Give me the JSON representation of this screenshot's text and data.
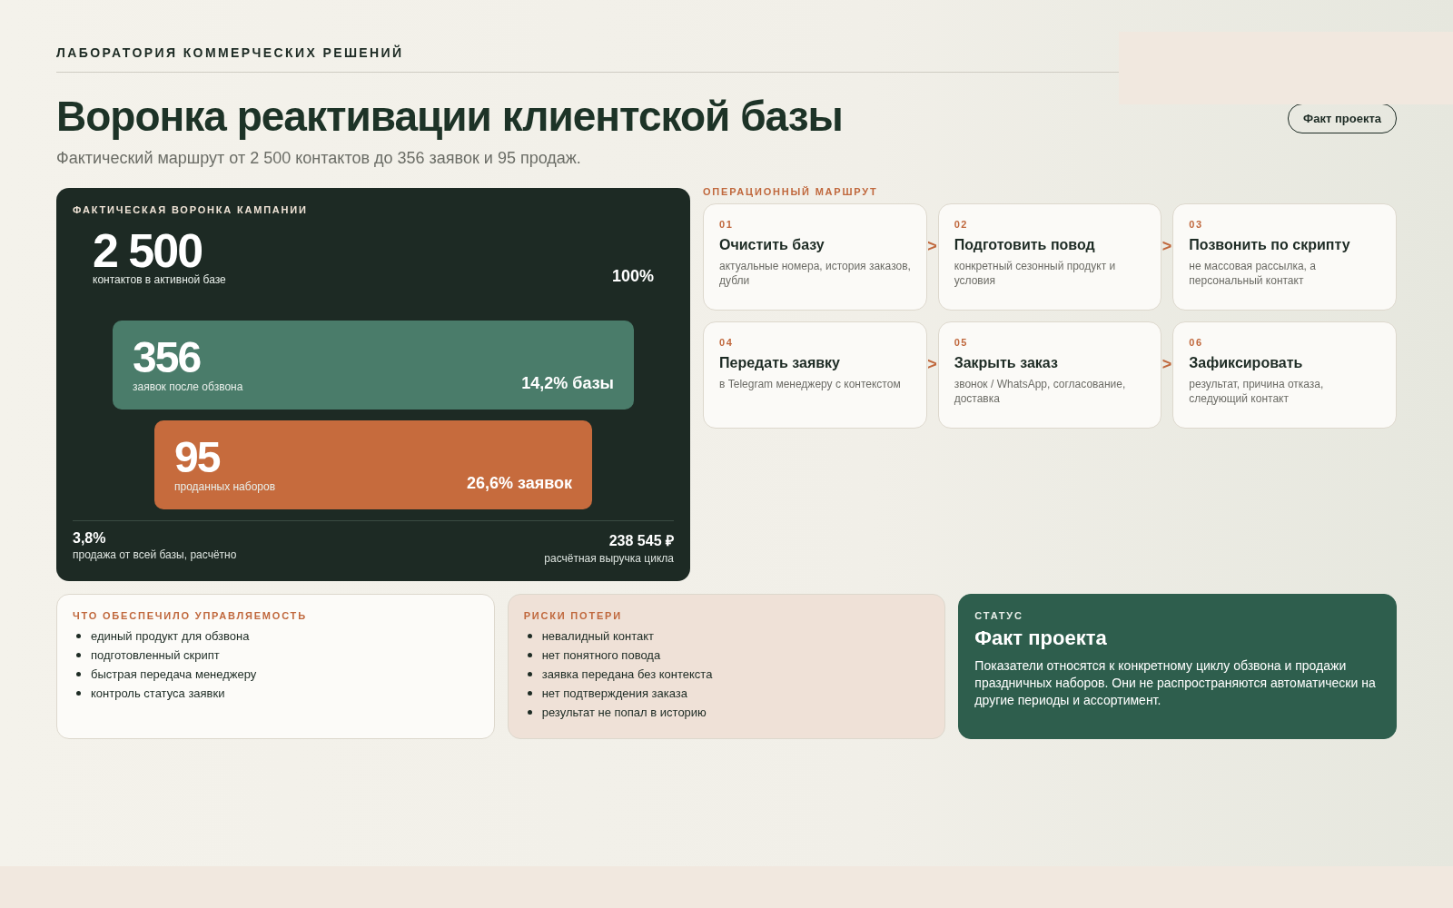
{
  "header": {
    "eyebrow": "ЛАБОРАТОРИЯ КОММЕРЧЕСКИХ РЕШЕНИЙ",
    "title": "Воронка реактивации клиентской базы",
    "subtitle": "Фактический маршрут от 2 500 контактов до 356 заявок и 95 продаж.",
    "badge": "Факт проекта"
  },
  "funnel": {
    "title": "ФАКТИЧЕСКАЯ ВОРОНКА КАМПАНИИ",
    "stages": [
      {
        "kind": "plain",
        "value": "2 500",
        "label": "контактов в активной базе",
        "share": "100%"
      },
      {
        "kind": "green",
        "value": "356",
        "label": "заявок после обзвона",
        "share": "14,2% базы"
      },
      {
        "kind": "orange",
        "value": "95",
        "label": "проданных наборов",
        "share": "26,6% заявок"
      }
    ],
    "totals": [
      {
        "value": "3,8%",
        "label": "продажа от всей базы, расчётно"
      },
      {
        "value": "238 545 ₽",
        "label": "расчётная выручка цикла"
      }
    ]
  },
  "route": {
    "title": "ОПЕРАЦИОННЫЙ МАРШРУТ",
    "steps": [
      {
        "number": "01",
        "title": "Очистить базу",
        "text": "актуальные номера, история заказов, дубли",
        "arrow": ">"
      },
      {
        "number": "02",
        "title": "Подготовить повод",
        "text": "конкретный сезонный продукт и условия",
        "arrow": ">"
      },
      {
        "number": "03",
        "title": "Позвонить по скрипту",
        "text": "не массовая рассылка, а персональный контакт"
      },
      {
        "number": "04",
        "title": "Передать заявку",
        "text": "в Telegram менеджеру с контекстом",
        "arrow": ">"
      },
      {
        "number": "05",
        "title": "Закрыть заказ",
        "text": "звонок / WhatsApp, согласование, доставка",
        "arrow": ">"
      },
      {
        "number": "06",
        "title": "Зафиксировать",
        "text": "результат, причина отказа, следующий контакт"
      }
    ]
  },
  "panels": [
    {
      "kind": "list",
      "title": "ЧТО ОБЕСПЕЧИЛО УПРАВЛЯЕМОСТЬ",
      "items": [
        "единый продукт для обзвона",
        "подготовленный скрипт",
        "быстрая передача менеджеру",
        "контроль статуса заявки"
      ]
    },
    {
      "kind": "risks",
      "title": "РИСКИ ПОТЕРИ",
      "items": [
        "невалидный контакт",
        "нет понятного повода",
        "заявка передана без контекста",
        "нет подтверждения заказа",
        "результат не попал в историю"
      ]
    },
    {
      "kind": "status",
      "title": "СТАТУС",
      "heading": "Факт проекта",
      "text": "Показатели относятся к конкретному циклу обзвона и продажи праздничных наборов. Они не распространяются автоматически на другие периоды и ассортимент."
    }
  ]
}
